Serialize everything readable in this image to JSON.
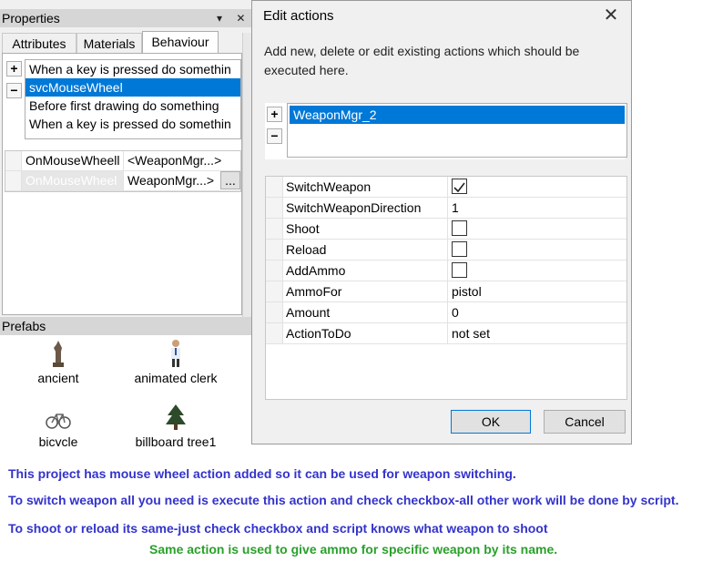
{
  "properties_panel": {
    "title": "Properties",
    "header_buttons": "▾ ✕",
    "tabs": [
      {
        "label": "Attributes"
      },
      {
        "label": "Materials"
      },
      {
        "label": "Behaviour"
      }
    ],
    "add_symbol": "+",
    "remove_symbol": "−",
    "behaviour_list": [
      "When a key is pressed do somethin",
      "svcMouseWheel",
      "Before first drawing do something",
      "When a key is pressed do somethin"
    ],
    "event_rows": [
      {
        "name": "OnMouseWheell",
        "value": "<WeaponMgr...>"
      },
      {
        "name": "OnMouseWheel",
        "value": "WeaponMgr...>",
        "button": "..."
      }
    ]
  },
  "prefabs_panel": {
    "title": "Prefabs",
    "items": [
      {
        "label": "ancient",
        "icon": "statue-icon"
      },
      {
        "label": "animated clerk",
        "icon": "person-icon"
      },
      {
        "label": "bicycle",
        "icon": "bicycle-icon"
      },
      {
        "label": "billboard tree1",
        "icon": "tree-icon"
      }
    ]
  },
  "dialog": {
    "title": "Edit actions",
    "close_symbol": "✕",
    "description": "Add new, delete or edit existing actions which should be executed here.",
    "add_symbol": "+",
    "remove_symbol": "−",
    "actions": [
      "WeaponMgr_2"
    ],
    "params": [
      {
        "name": "SwitchWeapon",
        "type": "checkbox",
        "checked": true
      },
      {
        "name": "SwitchWeaponDirection",
        "type": "text",
        "value": "1"
      },
      {
        "name": "Shoot",
        "type": "checkbox",
        "checked": false
      },
      {
        "name": "Reload",
        "type": "checkbox",
        "checked": false
      },
      {
        "name": "AddAmmo",
        "type": "checkbox",
        "checked": false
      },
      {
        "name": "AmmoFor",
        "type": "text",
        "value": "pistol"
      },
      {
        "name": "Amount",
        "type": "text",
        "value": "0"
      },
      {
        "name": "ActionToDo",
        "type": "text",
        "value": "not set"
      }
    ],
    "ok_label": "OK",
    "cancel_label": "Cancel"
  },
  "annotations": [
    {
      "text": "This project has mouse wheel action added so it can be used for weapon switching.",
      "color": "#3333cc"
    },
    {
      "text": "To switch weapon all you need is execute this action and check checkbox-all other work will be done by script.",
      "color": "#3333cc"
    },
    {
      "text": "To shoot or reload its same-just check checkbox and script knows what weapon to shoot",
      "color": "#3333cc"
    },
    {
      "text": "Same action is used to give ammo for specific weapon by its name.",
      "color": "#2aa02a"
    }
  ],
  "colors": {
    "selection": "#0078d7",
    "panel": "#f0f0f0",
    "header": "#d6d6d6"
  }
}
